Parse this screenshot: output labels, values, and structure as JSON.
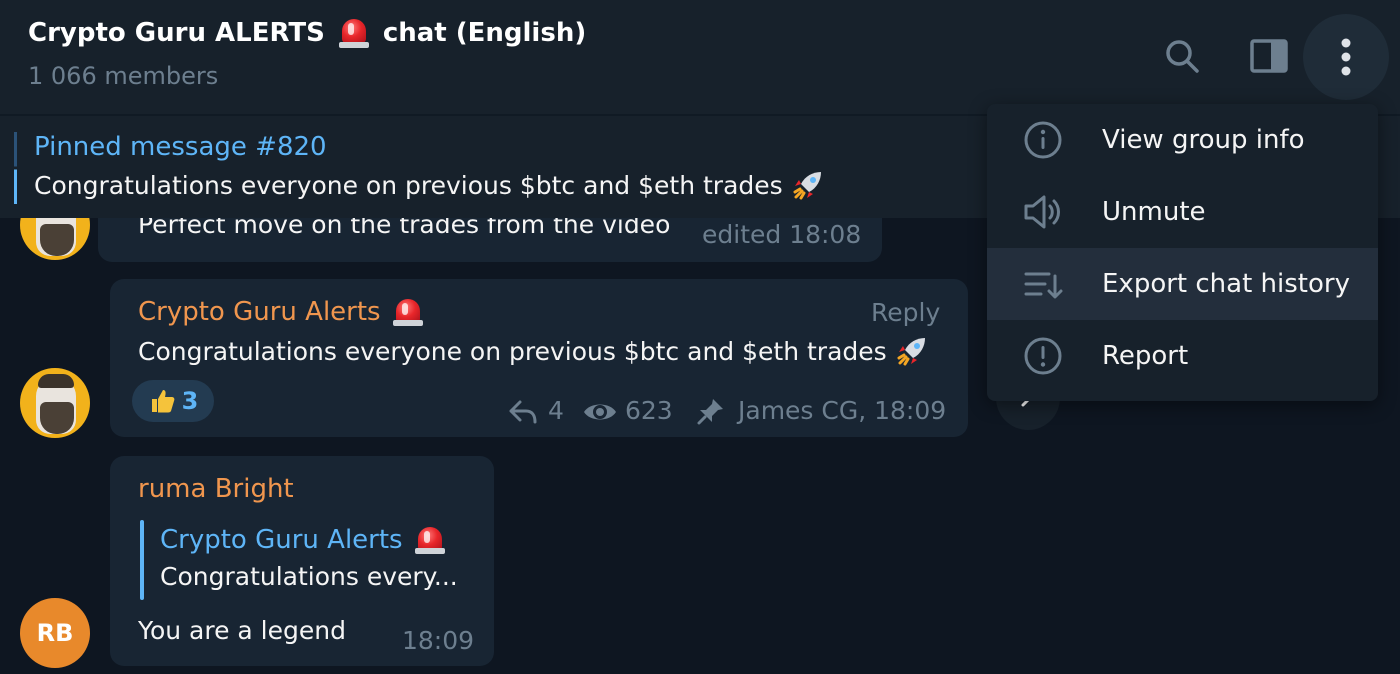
{
  "header": {
    "title_prefix": "Crypto Guru ALERTS",
    "title_suffix": "chat (English)",
    "title_emoji": "siren-icon",
    "members": "1 066 members",
    "icons": [
      "search-icon",
      "sidebar-toggle-icon",
      "more-vertical-icon"
    ]
  },
  "pinned": {
    "title": "Pinned message #820",
    "text": "Congratulations everyone on previous $btc and $eth trades",
    "emoji": "rocket-icon"
  },
  "messages": [
    {
      "text": "Perfect move on the trades from the video",
      "time": "edited 18:08"
    },
    {
      "sender": "Crypto Guru Alerts",
      "reply_label": "Reply",
      "text": "Congratulations everyone on previous $btc and $eth trades",
      "reaction_count": "3",
      "reaction_icon": "thumbs-up-icon",
      "replies": "4",
      "views": "623",
      "footer": "James CG, 18:09"
    },
    {
      "sender": "ruma Bright",
      "avatar_initials": "RB",
      "quote_sender": "Crypto Guru Alerts",
      "quote_text": "Congratulations every...",
      "text": "You are a legend",
      "time": "18:09"
    }
  ],
  "menu": {
    "items": [
      {
        "label": "View group info",
        "icon": "info-icon"
      },
      {
        "label": "Unmute",
        "icon": "speaker-icon"
      },
      {
        "label": "Export chat history",
        "icon": "export-history-icon"
      },
      {
        "label": "Report",
        "icon": "report-icon"
      }
    ]
  },
  "colors": {
    "background": "#0e1621",
    "panel": "#17212b",
    "bubble": "#182533",
    "accent_blue": "#5eb5f7",
    "sender_orange": "#f0964e",
    "muted": "#6d7f8f",
    "avatar_yellow": "#f2b21b",
    "avatar_orange": "#e8892b"
  }
}
